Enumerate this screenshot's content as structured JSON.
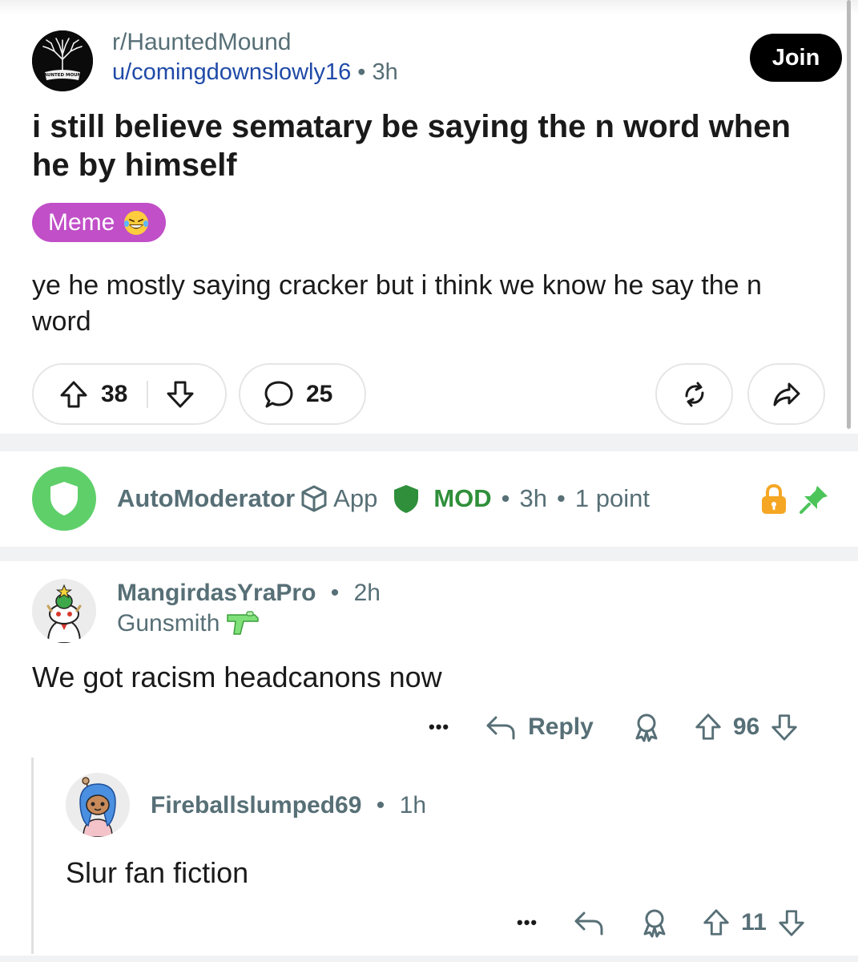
{
  "post": {
    "subreddit": "r/HauntedMound",
    "subreddit_avatar_text": "HAUNTED MOUND",
    "author": "u/comingdownslowly16",
    "separator": "•",
    "age": "3h",
    "join_label": "Join",
    "title": "i still believe sematary be saying the n word when he by himself",
    "flair_text": "Meme",
    "flair_color": "#c14fc8",
    "body": "ye he mostly saying cracker but i think we know he say the n word",
    "score": "38",
    "comment_count": "25"
  },
  "automod": {
    "name": "AutoModerator",
    "app_label": "App",
    "mod_label": "MOD",
    "separator": "•",
    "age": "3h",
    "points": "1 point",
    "mod_color": "#2f8f3a"
  },
  "comments": [
    {
      "username": "MangirdasYraPro",
      "separator": "•",
      "age": "2h",
      "user_flair": "Gunsmith",
      "text": "We got racism headcanons now",
      "more_label": "•••",
      "reply_label": "Reply",
      "score": "96"
    },
    {
      "username": "Fireballslumped69",
      "separator": "•",
      "age": "1h",
      "text": "Slur fan fiction",
      "more_label": "•••",
      "score": "11"
    }
  ],
  "colors": {
    "link_blue": "#1f4aa8",
    "meta_gray": "#576f76",
    "automod_green": "#5fcf6a",
    "lock_orange": "#f5a623",
    "pin_green": "#4cc45a"
  }
}
